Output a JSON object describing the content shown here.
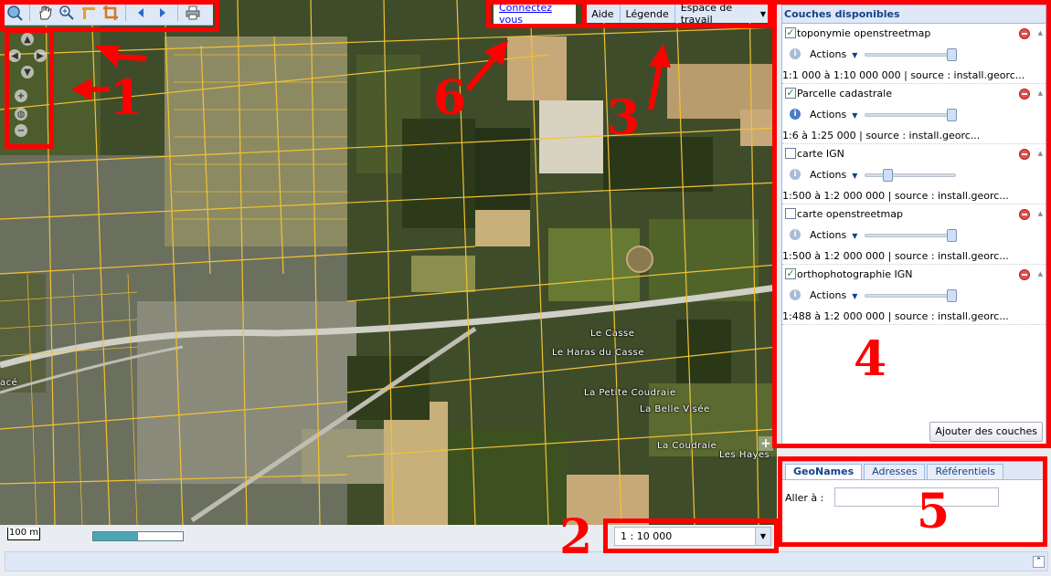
{
  "toolbar": {
    "tools": [
      {
        "icon": "globe-zoom-icon"
      },
      {
        "icon": "pan-hand-icon"
      },
      {
        "icon": "zoom-in-icon"
      },
      {
        "icon": "measure-ruler-icon"
      },
      {
        "icon": "crop-area-icon"
      },
      {
        "icon": "previous-arrow-icon"
      },
      {
        "icon": "next-arrow-icon"
      },
      {
        "icon": "print-icon"
      }
    ]
  },
  "top_links": {
    "connect": "Connectez vous",
    "help": "Aide",
    "legend": "Légende",
    "workspace": "Espace de travail"
  },
  "map": {
    "place_labels": [
      "Le Casse",
      "Le Haras du Casse",
      "La Petite Coudraie",
      "La Belle Visée",
      "La Coudraie",
      "Les Hayes",
      "acé"
    ],
    "scale_line": "100 m",
    "loading_progress": 0.5,
    "scale_select": "1 : 10 000",
    "colors": {
      "parcel": "#f2c233",
      "field_dark": "#2f3d1c",
      "field_light": "#c7b07a"
    }
  },
  "layers_panel": {
    "title": "Couches disponibles",
    "layers": [
      {
        "name": "toponymie openstreetmap",
        "checked": true,
        "actions": "Actions",
        "opacity": 0.95,
        "meta": "1:1 000 à 1:10 000 000 | source : install.georc..."
      },
      {
        "name": "Parcelle cadastrale",
        "checked": true,
        "actions": "Actions",
        "opacity": 0.95,
        "meta": "1:6 à 1:25 000 | source : install.georc..."
      },
      {
        "name": "carte IGN",
        "checked": false,
        "actions": "Actions",
        "opacity": 0.25,
        "meta": "1:500 à 1:2 000 000 | source : install.georc..."
      },
      {
        "name": "carte openstreetmap",
        "checked": false,
        "actions": "Actions",
        "opacity": 0.95,
        "meta": "1:500 à 1:2 000 000 | source : install.georc..."
      },
      {
        "name": "orthophotographie IGN",
        "checked": true,
        "actions": "Actions",
        "opacity": 0.95,
        "meta": "1:488 à 1:2 000 000 | source : install.georc..."
      }
    ],
    "add_button": "Ajouter des couches"
  },
  "search_panel": {
    "tabs": [
      "GeoNames",
      "Adresses",
      "Référentiels"
    ],
    "active_tab": "GeoNames",
    "goto_label": "Aller à :",
    "goto_value": ""
  },
  "annotations": [
    "1",
    "2",
    "3",
    "4",
    "5",
    "6"
  ]
}
